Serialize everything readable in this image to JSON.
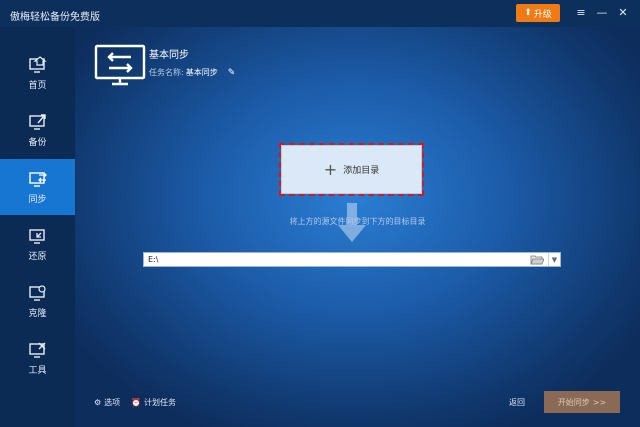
{
  "app": {
    "title": "傲梅轻松备份免费版"
  },
  "titlebar": {
    "upgrade_label": "升级",
    "controls": [
      {
        "icon": "menu-icon",
        "glyph": "≡"
      },
      {
        "icon": "minimize-icon",
        "glyph": "—"
      },
      {
        "icon": "close-icon",
        "glyph": "✕"
      }
    ]
  },
  "sidebar": {
    "items": [
      {
        "label": "首页",
        "icon": "home-icon",
        "active": false
      },
      {
        "label": "备份",
        "icon": "backup-icon",
        "active": false
      },
      {
        "label": "同步",
        "icon": "sync-icon",
        "active": true
      },
      {
        "label": "还原",
        "icon": "restore-icon",
        "active": false
      },
      {
        "label": "克隆",
        "icon": "clone-icon",
        "active": false
      },
      {
        "label": "工具",
        "icon": "tools-icon",
        "active": false
      }
    ]
  },
  "task": {
    "title": "基本同步",
    "name_label": "任务名称:",
    "name_value": "基本同步"
  },
  "add_dir": {
    "label": "添加目录"
  },
  "hint": "将上方的源文件同步到下方的目标目录",
  "path": {
    "value": "E:\\"
  },
  "footer": {
    "options_label": "选项",
    "schedule_label": "计划任务",
    "back_label": "返回",
    "start_label": "开始同步",
    "start_suffix": ">>"
  },
  "colors": {
    "accent": "#1676d2",
    "upgrade": "#f07b14",
    "highlight_border": "#d01c1c",
    "start_button": "#8a6a55"
  }
}
